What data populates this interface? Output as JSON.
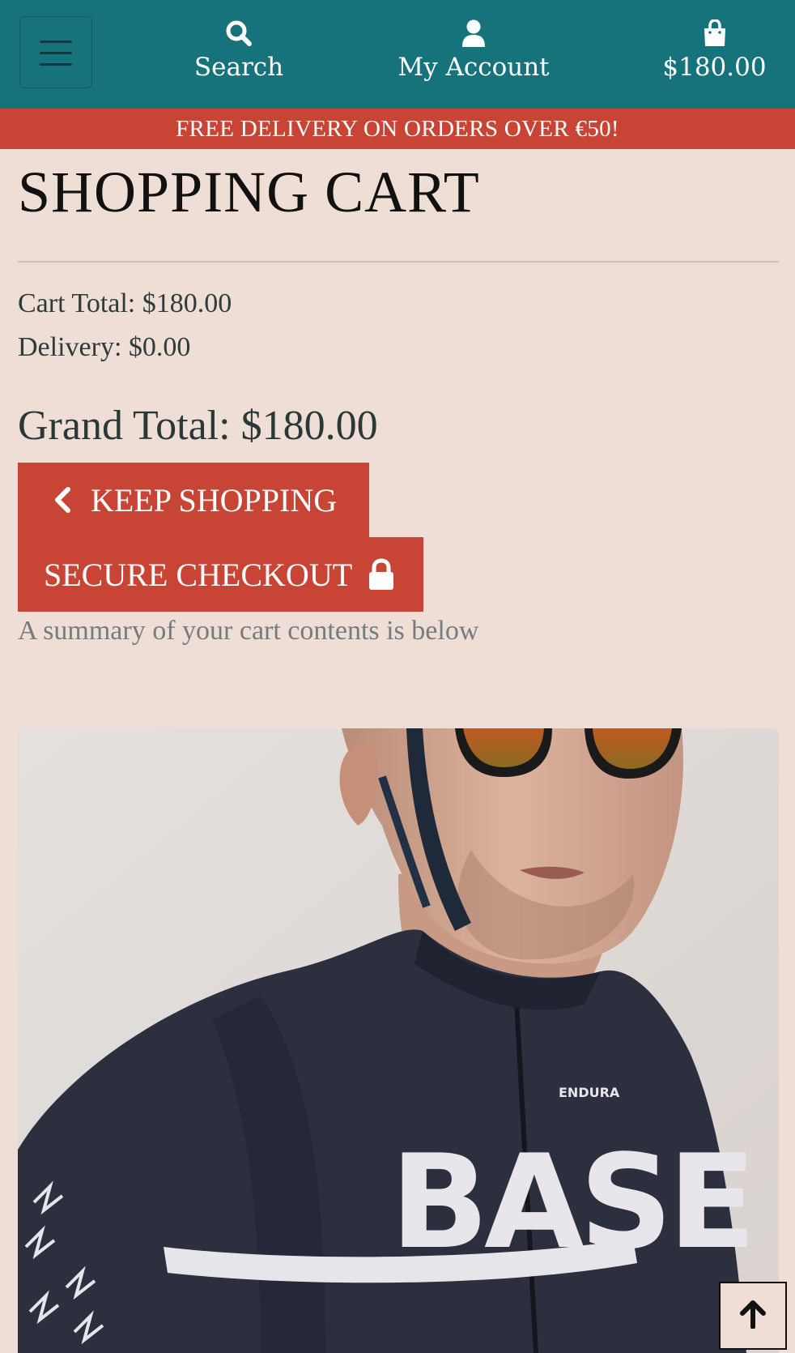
{
  "header": {
    "menu_icon": "hamburger-icon",
    "search_label": "Search",
    "search_icon": "search-icon",
    "account_label": "My Account",
    "account_icon": "user-icon",
    "cart_total": "$180.00",
    "cart_icon": "shopping-bag-icon"
  },
  "promo": {
    "text": "FREE DELIVERY ON ORDERS OVER €50!"
  },
  "cart": {
    "title": "SHOPPING CART",
    "cart_total": "Cart Total: $180.00",
    "delivery": "Delivery: $0.00",
    "grand_total": "Grand Total: $180.00",
    "keep_shopping": "KEEP SHOPPING",
    "secure_checkout": "SECURE CHECKOUT",
    "summary_note": "A summary of your cart contents is below"
  },
  "product": {
    "image_alt": "ENDURA",
    "jersey_text": "BASE"
  },
  "colors": {
    "header_bg": "#16737b",
    "promo_bg": "#c84536",
    "page_bg": "#efded6",
    "button_bg": "#c84536"
  },
  "back_to_top_icon": "arrow-up-icon"
}
